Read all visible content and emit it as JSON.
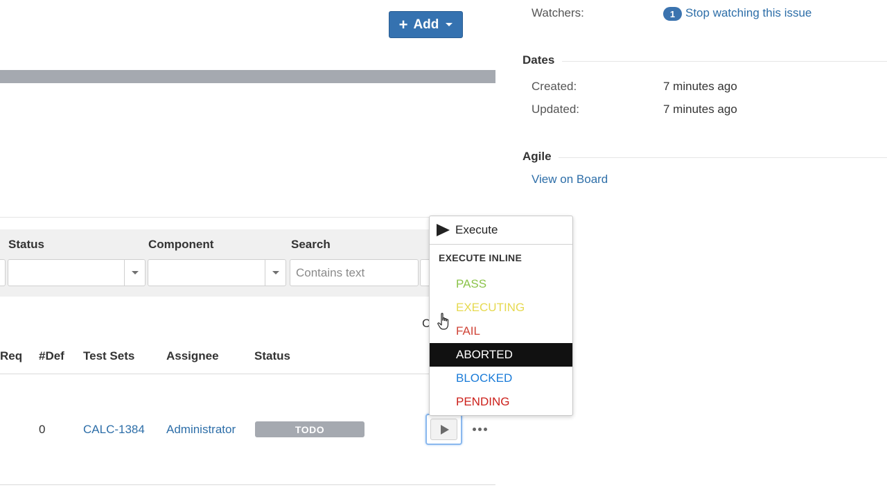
{
  "toolbar": {
    "add_label": "Add"
  },
  "filters": {
    "status_label": "Status",
    "component_label": "Component",
    "search_label": "Search",
    "search_placeholder": "Contains text",
    "clipped_text": "C"
  },
  "table": {
    "headers": {
      "req": "Req",
      "def": "#Def",
      "test_sets": "Test Sets",
      "assignee": "Assignee",
      "status": "Status"
    },
    "row": {
      "def": "0",
      "test_set": "CALC-1384",
      "assignee": "Administrator",
      "status": "TODO"
    }
  },
  "details": {
    "watchers_label": "Watchers:",
    "watchers_count": "1",
    "watch_link": "Stop watching this issue",
    "dates_title": "Dates",
    "created_label": "Created:",
    "created_value": "7 minutes ago",
    "updated_label": "Updated:",
    "updated_value": "7 minutes ago",
    "agile_title": "Agile",
    "view_board": "View on Board"
  },
  "menu": {
    "execute_label": "Execute",
    "heading": "EXECUTE INLINE",
    "items": [
      {
        "label": "PASS",
        "color": "#8bc34a"
      },
      {
        "label": "EXECUTING",
        "color": "#e6d950"
      },
      {
        "label": "FAIL",
        "color": "#d04437"
      },
      {
        "label": "ABORTED",
        "color": "#ffffff"
      },
      {
        "label": "BLOCKED",
        "color": "#1a7bd8"
      },
      {
        "label": "PENDING",
        "color": "#cc1f1a"
      }
    ]
  },
  "colors": {
    "primary_button": "#3572b0",
    "link": "#2d6ea8",
    "todo_lozenge": "#a5a9b0",
    "active_menu_item": "#111111"
  }
}
